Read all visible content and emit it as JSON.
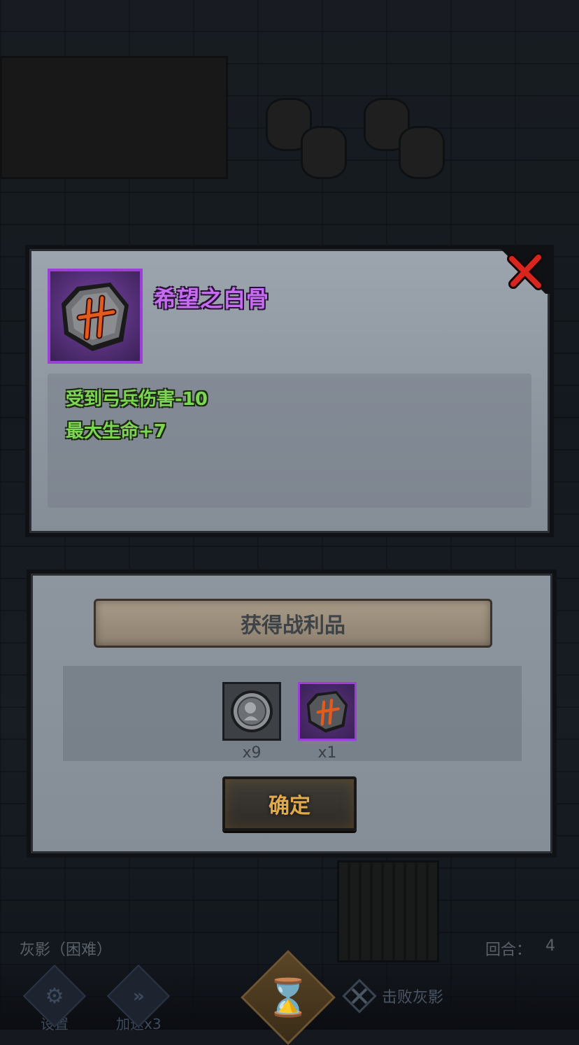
{
  "item_detail": {
    "name": "希望之白骨",
    "rarity_color": "#9b3fd6",
    "icon": "rune-stone-icon",
    "stats": [
      "受到弓兵伤害-10",
      "最大生命+7"
    ],
    "close_icon": "close-x-icon"
  },
  "loot": {
    "title": "获得战利品",
    "items": [
      {
        "icon": "silver-coin-icon",
        "count": "x9"
      },
      {
        "icon": "rune-stone-icon",
        "count": "x1"
      }
    ],
    "confirm_label": "确定"
  },
  "hud": {
    "enemy_label": "灰影（困难）",
    "round_label": "回合：",
    "round_value": "4",
    "settings_label": "设置",
    "speed_label": "加速x3",
    "objective_label": "击败灰影"
  },
  "colors": {
    "item_name": "#c56cf0",
    "stat_text": "#7ed454",
    "confirm_text": "#e0a94a"
  }
}
